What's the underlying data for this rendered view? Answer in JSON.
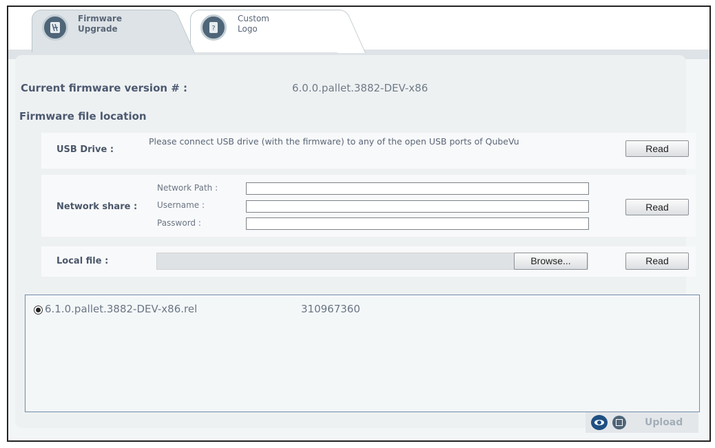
{
  "tabs": [
    {
      "label_line1": "Firmware",
      "label_line2": "Upgrade",
      "active": true
    },
    {
      "label_line1": "Custom",
      "label_line2": "Logo",
      "active": false
    }
  ],
  "current_firmware": {
    "label": "Current firmware version # :",
    "value": "6.0.0.pallet.3882-DEV-x86"
  },
  "file_location": {
    "heading": "Firmware file location",
    "usb": {
      "label": "USB Drive :",
      "message": "Please connect USB drive (with the firmware) to any of the open USB ports of QubeVu",
      "read_label": "Read"
    },
    "network": {
      "label": "Network share :",
      "path_label": "Network Path :",
      "path_value": "",
      "username_label": "Username :",
      "username_value": "",
      "password_label": "Password :",
      "password_value": "",
      "read_label": "Read"
    },
    "local": {
      "label": "Local file :",
      "browse_label": "Browse...",
      "read_label": "Read"
    }
  },
  "file_list": [
    {
      "name": "6.1.0.pallet.3882-DEV-x86.rel",
      "size": "310967360",
      "selected": true
    }
  ],
  "footer": {
    "upload_label": "Upload",
    "icons": [
      "eye-icon",
      "add-icon"
    ]
  },
  "colors": {
    "panel": "#eef1f2",
    "accent": "#1f4f82",
    "list_border": "#6e8aa8"
  }
}
